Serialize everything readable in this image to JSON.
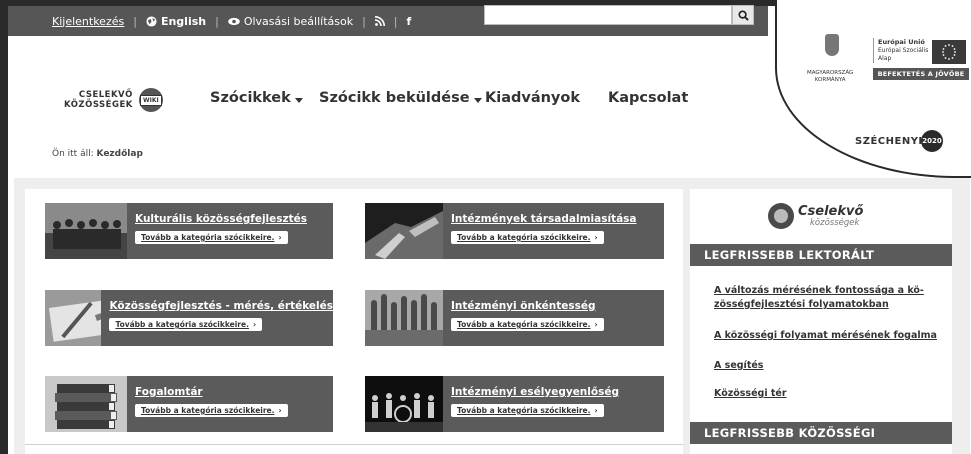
{
  "topbar": {
    "login": "Kijelentkezés",
    "language": "English",
    "reading_settings": "Olvasási beállítások",
    "rss_icon": "rss-icon",
    "facebook": "f",
    "search_placeholder": ""
  },
  "logo": {
    "line1": "CSELEKVŐ",
    "line2": "KÖZÖSSÉGEK",
    "badge": "WIKI"
  },
  "nav": {
    "items": [
      {
        "label": "Szócikkek",
        "dropdown": true
      },
      {
        "label": "Szócikk beküldése",
        "dropdown": true
      },
      {
        "label": "Kiadványok",
        "dropdown": false
      },
      {
        "label": "Kapcsolat",
        "dropdown": false
      }
    ]
  },
  "breadcrumb": {
    "prefix": "Ön itt áll:",
    "current": "Kezdőlap"
  },
  "szechenyi": {
    "eu_line1": "Európai Unió",
    "eu_line2": "Európai Szociális",
    "eu_line3": "Alap",
    "hu_line1": "MAGYARORSZÁG",
    "hu_line2": "KORMÁNYA",
    "invest": "BEFEKTETÉS A JÖVŐBE",
    "name": "SZÉCHENYI",
    "year": "2020"
  },
  "cards": [
    {
      "title": "Kulturális közösségfejlesztés",
      "more": "Tovább a kategória szócikkeire."
    },
    {
      "title": "Intézmények társadalmiasítása",
      "more": "Tovább a kategória szócikkeire."
    },
    {
      "title": "Közösségfejlesztés - mérés, értékelés",
      "more": "Tovább a kategória szócikkeire."
    },
    {
      "title": "Intézményi önkéntesség",
      "more": "Tovább a kategória szócikkeire."
    },
    {
      "title": "Fogalomtár",
      "more": "Tovább a kategória szócikkeire."
    },
    {
      "title": "Intézményi esélyegyenlőség",
      "more": "Tovább a kategória szócikkeire."
    }
  ],
  "sidebar": {
    "logo_line1": "Cselekvő",
    "logo_line2": "közösségek",
    "heading1": "LEGFRISSEBB LEKTORÁLT SZÓCIKKEK",
    "links": [
      "A változás mérésének fontossága a kö-zösségfejlesztési folyamatokban",
      "A közösségi folyamat mérésének fogalma",
      "A segítés",
      "Közösségi tér"
    ],
    "heading2": "LEGFRISSEBB KÖZÖSSÉGI SZÓCIKKEK"
  }
}
